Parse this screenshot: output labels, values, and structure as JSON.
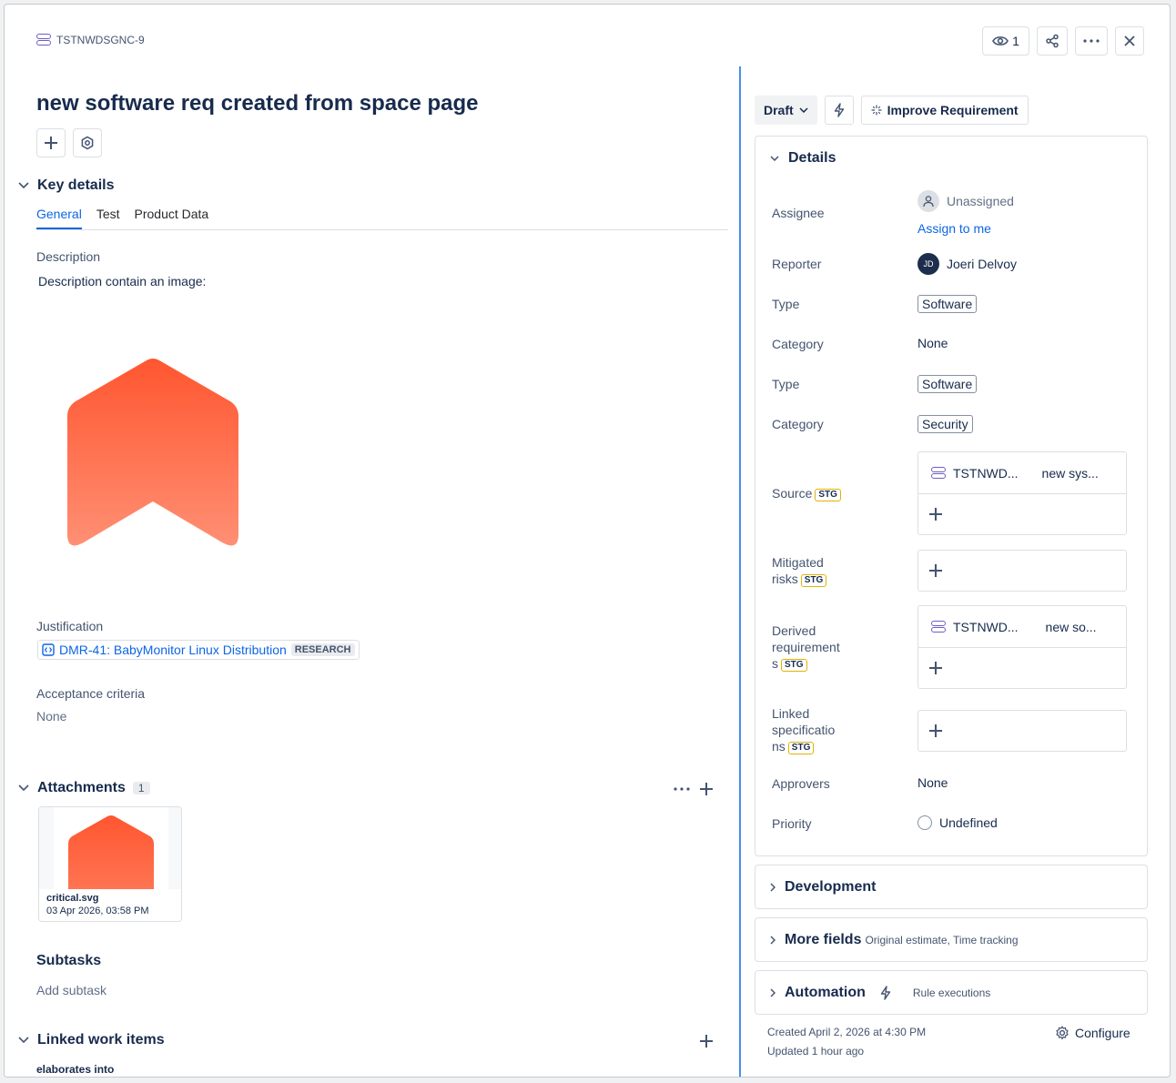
{
  "header": {
    "issue_key": "TSTNWDSGNC-9",
    "watch_count": "1",
    "title": "new software req created from space page"
  },
  "key_details": {
    "heading": "Key details",
    "tabs": [
      {
        "label": "General"
      },
      {
        "label": "Test"
      },
      {
        "label": "Product Data"
      }
    ],
    "description_label": "Description",
    "description_text": "Description contain an image:",
    "justification_label": "Justification",
    "justification_link": "DMR-41: BabyMonitor Linux Distribution",
    "justification_badge": "RESEARCH",
    "acceptance_label": "Acceptance criteria",
    "acceptance_value": "None"
  },
  "attachments": {
    "heading": "Attachments",
    "count": "1",
    "file_name": "critical.svg",
    "file_date": "03 Apr 2026, 03:58 PM"
  },
  "subtasks": {
    "heading": "Subtasks",
    "add_label": "Add subtask"
  },
  "linked_work": {
    "heading": "Linked work items",
    "relation": "elaborates into"
  },
  "right_panel": {
    "status": "Draft",
    "improve_label": "Improve Requirement",
    "details_heading": "Details",
    "assignee_label": "Assignee",
    "assignee_value": "Unassigned",
    "assign_to_me": "Assign to me",
    "reporter_label": "Reporter",
    "reporter_initials": "JD",
    "reporter_value": "Joeri Delvoy",
    "type_label": "Type",
    "type_value": "Software",
    "category_label": "Category",
    "category_value": "None",
    "type2_label": "Type",
    "type2_value": "Software",
    "category2_label": "Category",
    "category2_value": "Security",
    "stg_badge": "STG",
    "source_label": "Source",
    "source_key": "TSTNWD...",
    "source_summary": "new sys...",
    "mitigated_label_1": "Mitigated",
    "mitigated_label_2": "risks",
    "derived_label_1": "Derived",
    "derived_label_2": "requirement",
    "derived_label_3": "s",
    "derived_key": "TSTNWD...",
    "derived_summary": "new so...",
    "linked_spec_label_1": "Linked",
    "linked_spec_label_2": "specificatio",
    "linked_spec_label_3": "ns",
    "approvers_label": "Approvers",
    "approvers_value": "None",
    "priority_label": "Priority",
    "priority_value": "Undefined",
    "development_heading": "Development",
    "more_fields_heading": "More fields",
    "more_fields_sub": "Original estimate, Time tracking",
    "automation_heading": "Automation",
    "automation_sub": "Rule executions",
    "created": "Created April 2, 2026 at 4:30 PM",
    "updated": "Updated 1 hour ago",
    "configure_label": "Configure"
  },
  "colors": {
    "accent": "#0c66e4",
    "logo_top": "#ff5630",
    "logo_bottom": "#ff8f73",
    "divider": "#4a8df0"
  }
}
